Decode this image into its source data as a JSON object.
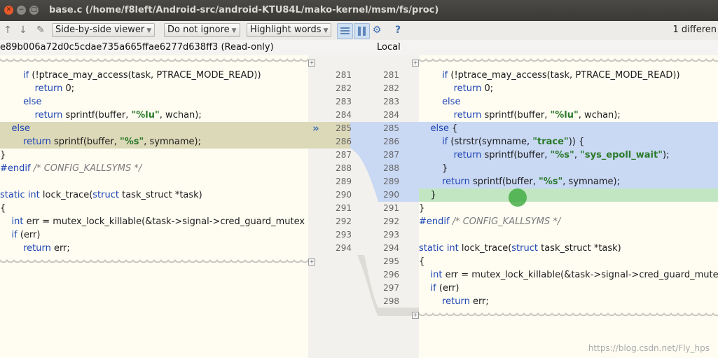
{
  "window": {
    "title": "base.c (/home/f8left/Android-src/android-KTU84L/mako-kernel/msm/fs/proc)",
    "close_glyph": "✕",
    "min_glyph": "−",
    "max_glyph": "□"
  },
  "toolbar": {
    "prev_icon": "↑",
    "next_icon": "↓",
    "edit_icon": "✎",
    "viewer_label": "Side-by-side viewer",
    "ignore_label": "Do not ignore",
    "highlight_label": "Highlight words",
    "settings_icon": "⚙",
    "help_icon": "?",
    "diff_count": "1 differen"
  },
  "header": {
    "left_revision": "e89b006a72d0c5cdae735a665ffae6277d638ff3 (Read-only)",
    "right_revision": "Local"
  },
  "gutter": {
    "chevron": "»",
    "left_numbers": [
      "281",
      "282",
      "283",
      "284",
      "285",
      "286",
      "287",
      "288",
      "289",
      "290",
      "291",
      "292",
      "293",
      "294"
    ],
    "right_numbers": [
      "281",
      "282",
      "283",
      "284",
      "285",
      "286",
      "287",
      "288",
      "289",
      "290",
      "291",
      "292",
      "293",
      "294",
      "295",
      "296",
      "297",
      "298"
    ]
  },
  "left_lines": [
    "        if (!ptrace_may_access(task, PTRACE_MODE_READ))",
    "            return 0;",
    "        else",
    "            return sprintf(buffer, \"%lu\", wchan);",
    "    else",
    "        return sprintf(buffer, \"%s\", symname);",
    "}",
    "#endif /* CONFIG_KALLSYMS */",
    "",
    "static int lock_trace(struct task_struct *task)",
    "{",
    "    int err = mutex_lock_killable(&task->signal->cred_guard_mutex",
    "    if (err)",
    "        return err;"
  ],
  "right_lines": [
    "        if (!ptrace_may_access(task, PTRACE_MODE_READ))",
    "            return 0;",
    "        else",
    "            return sprintf(buffer, \"%lu\", wchan);",
    "    else {",
    "        if (strstr(symname, \"trace\")) {",
    "            return sprintf(buffer, \"%s\", \"sys_epoll_wait\");",
    "        }",
    "        return sprintf(buffer, \"%s\", symname);",
    "    }",
    "}",
    "#endif /* CONFIG_KALLSYMS */",
    "",
    "static int lock_trace(struct task_struct *task)",
    "{",
    "    int err = mutex_lock_killable(&task->signal->cred_guard_mutex)",
    "    if (err)",
    "        return err;"
  ],
  "watermark": "https://blog.csdn.net/Fly_hps"
}
